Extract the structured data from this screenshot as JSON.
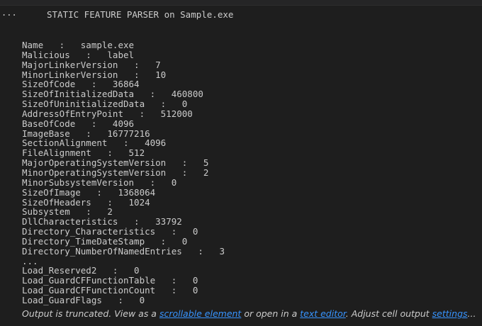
{
  "gutter": {
    "ellipsis": "..."
  },
  "title": "STATIC FEATURE PARSER on Sample.exe",
  "lines": [
    "Name   :   sample.exe",
    "Malicious   :   label",
    "MajorLinkerVersion   :   7",
    "MinorLinkerVersion   :   10",
    "SizeOfCode   :   36864",
    "SizeOfInitializedData   :   460800",
    "SizeOfUninitializedData   :   0",
    "AddressOfEntryPoint   :   512000",
    "BaseOfCode   :   4096",
    "ImageBase   :   16777216",
    "SectionAlignment   :   4096",
    "FileAlignment   :   512",
    "MajorOperatingSystemVersion   :   5",
    "MinorOperatingSystemVersion   :   2",
    "MinorSubsystemVersion   :   0",
    "SizeOfImage   :   1368064",
    "SizeOfHeaders   :   1024",
    "Subsystem   :   2",
    "DllCharacteristics   :   33792",
    "Directory_Characteristics   :   0",
    "Directory_TimeDateStamp   :   0",
    "Directory_NumberOfNamedEntries   :   3",
    "...",
    "Load_Reserved2   :   0",
    "Load_GuardCFFunctionTable   :   0",
    "Load_GuardCFFunctionCount   :   0",
    "Load_GuardFlags   :   0"
  ],
  "notice": {
    "prefix": "Output is truncated. View as a ",
    "link_scrollable": "scrollable element",
    "middle": " or open in a ",
    "link_editor": "text editor",
    "suffix": ". Adjust cell output ",
    "link_settings": "settings",
    "ending": "..."
  },
  "colors": {
    "background": "#1e1e1e",
    "text": "#cccccc",
    "link": "#3794ff"
  }
}
